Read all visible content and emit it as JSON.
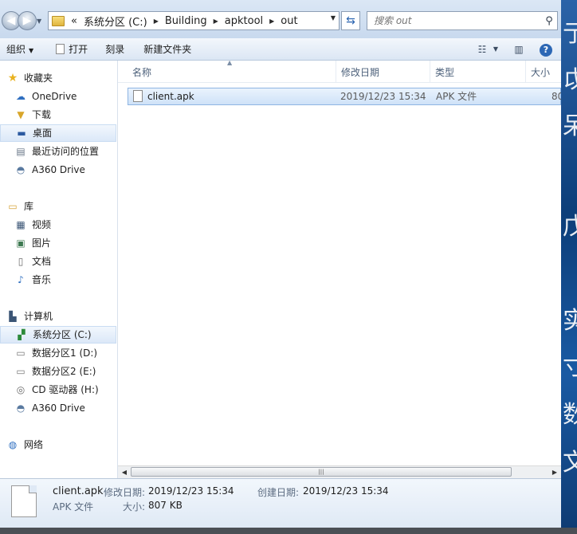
{
  "address": {
    "overflow": "«",
    "crumbs": [
      "系统分区 (C:)",
      "Building",
      "apktool",
      "out"
    ]
  },
  "search": {
    "placeholder": "搜索 out"
  },
  "toolbar": {
    "organize": "组织",
    "open": "打开",
    "burn": "刻录",
    "new_folder": "新建文件夹"
  },
  "nav": {
    "favorites": {
      "label": "收藏夹",
      "items": [
        "OneDrive",
        "下载",
        "桌面",
        "最近访问的位置",
        "A360 Drive"
      ]
    },
    "libraries": {
      "label": "库",
      "items": [
        "视频",
        "图片",
        "文档",
        "音乐"
      ]
    },
    "computer": {
      "label": "计算机",
      "items": [
        "系统分区 (C:)",
        "数据分区1 (D:)",
        "数据分区2 (E:)",
        "CD 驱动器 (H:)",
        "A360 Drive"
      ]
    },
    "network": {
      "label": "网络"
    }
  },
  "columns": {
    "name": "名称",
    "modified": "修改日期",
    "type": "类型",
    "size": "大小"
  },
  "files": [
    {
      "name": "client.apk",
      "modified": "2019/12/23 15:34",
      "type": "APK 文件",
      "size": "80"
    }
  ],
  "details": {
    "name": "client.apk",
    "type": "APK 文件",
    "modified_label": "修改日期:",
    "modified": "2019/12/23 15:34",
    "created_label": "创建日期:",
    "created": "2019/12/23 15:34",
    "size_label": "大小:",
    "size": "807 KB"
  },
  "desktop_glyphs": [
    "亍",
    "戉",
    "呆",
    "戊",
    "实",
    "寸",
    "数",
    "文"
  ],
  "colors": {
    "selection": "#cfe2f8",
    "chrome": "#dbe7f5",
    "accent": "#2c67b5"
  }
}
